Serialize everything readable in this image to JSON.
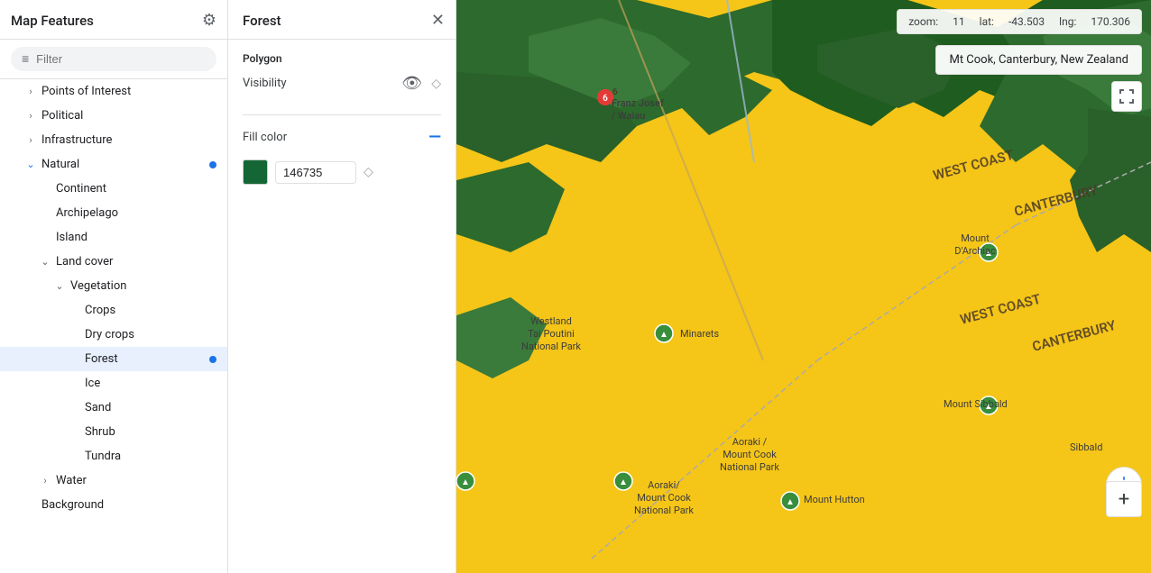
{
  "sidebar": {
    "title": "Map Features",
    "filter_placeholder": "Filter",
    "items": [
      {
        "id": "points-of-interest",
        "label": "Points of Interest",
        "indent": 1,
        "chevron": "›",
        "dot": false
      },
      {
        "id": "political",
        "label": "Political",
        "indent": 1,
        "chevron": "›",
        "dot": false
      },
      {
        "id": "infrastructure",
        "label": "Infrastructure",
        "indent": 1,
        "chevron": "›",
        "dot": false
      },
      {
        "id": "natural",
        "label": "Natural",
        "indent": 1,
        "chevron": "∨",
        "dot": true,
        "expanded": true
      },
      {
        "id": "continent",
        "label": "Continent",
        "indent": 2,
        "dot": false
      },
      {
        "id": "archipelago",
        "label": "Archipelago",
        "indent": 2,
        "dot": false
      },
      {
        "id": "island",
        "label": "Island",
        "indent": 2,
        "dot": false
      },
      {
        "id": "land-cover",
        "label": "Land cover",
        "indent": 2,
        "chevron": "∨",
        "dot": false,
        "expanded": true
      },
      {
        "id": "vegetation",
        "label": "Vegetation",
        "indent": 3,
        "chevron": "∨",
        "dot": false,
        "expanded": true
      },
      {
        "id": "crops",
        "label": "Crops",
        "indent": 4,
        "dot": false
      },
      {
        "id": "dry-crops",
        "label": "Dry crops",
        "indent": 4,
        "dot": false
      },
      {
        "id": "forest",
        "label": "Forest",
        "indent": 4,
        "dot": true,
        "selected": true
      },
      {
        "id": "ice",
        "label": "Ice",
        "indent": 4,
        "dot": false
      },
      {
        "id": "sand",
        "label": "Sand",
        "indent": 4,
        "dot": false
      },
      {
        "id": "shrub",
        "label": "Shrub",
        "indent": 4,
        "dot": false
      },
      {
        "id": "tundra",
        "label": "Tundra",
        "indent": 4,
        "dot": false
      },
      {
        "id": "water",
        "label": "Water",
        "indent": 2,
        "chevron": "›",
        "dot": false
      },
      {
        "id": "background",
        "label": "Background",
        "indent": 1,
        "dot": false
      }
    ]
  },
  "feature_panel": {
    "title": "Forest",
    "section_polygon": "Polygon",
    "field_visibility": "Visibility",
    "field_fill_color": "Fill color",
    "fill_color_value": "146735",
    "fill_color_hex": "#146735"
  },
  "map": {
    "zoom_label": "zoom:",
    "zoom_value": "11",
    "lat_label": "lat:",
    "lat_value": "-43.503",
    "lng_label": "lng:",
    "lng_value": "170.306",
    "location_tooltip": "Mt Cook, Canterbury, New Zealand",
    "expand_icon": "⛶",
    "location_icon": "◎",
    "zoom_plus_icon": "+"
  },
  "icons": {
    "gear": "⚙",
    "filter": "≡",
    "close": "✕",
    "chevron_right": "›",
    "chevron_down": "⌄",
    "visibility": "👁",
    "diamond": "◇",
    "minus": "—"
  }
}
